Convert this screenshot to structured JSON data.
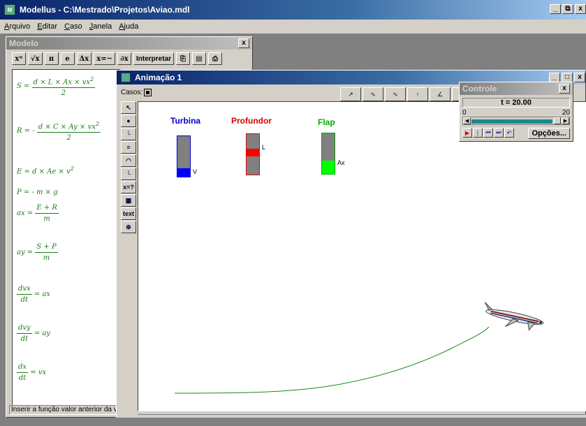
{
  "app": {
    "title": "Modellus - C:\\Mestrado\\Projetos\\Aviao.mdl",
    "min": "_",
    "max": "🗗",
    "close": "x"
  },
  "menu": [
    "Arquivo",
    "Editar",
    "Caso",
    "Janela",
    "Ajuda"
  ],
  "modelo": {
    "title": "Modelo",
    "close": "x",
    "toolbar": [
      "xⁿ",
      "√x",
      "π",
      "e",
      "Δx",
      "x=~",
      "∂x",
      "Interpretar"
    ],
    "status": "Inserir a função valor anterior da var",
    "equations": {
      "S": {
        "lhs": "S =",
        "num": "d × L × Ax × vx",
        "exp": "2",
        "den": "2"
      },
      "R": {
        "lhs": "R = -",
        "num": "d × C × Ay × vx",
        "exp": "2",
        "den": "2"
      },
      "E": {
        "text": "E = d × Ae × v",
        "exp": "2"
      },
      "P": {
        "text": "P = - m × g"
      },
      "ax": {
        "lhs": "ax =",
        "num": "E + R",
        "den": "m"
      },
      "ay": {
        "lhs": "ay =",
        "num": "S + P",
        "den": "m"
      },
      "dvx": {
        "num": "dvx",
        "den": "dt",
        "rhs": "= ax"
      },
      "dvy": {
        "num": "dvy",
        "den": "dt",
        "rhs": "= ay"
      },
      "dx": {
        "num": "dx",
        "den": "dt",
        "rhs": "= vx"
      }
    }
  },
  "animacao": {
    "title": "Animação 1",
    "casos_label": "Casos:",
    "left_tools": [
      "↖",
      "●",
      "└",
      "≡",
      "◠",
      "└",
      "x=?",
      "▦",
      "text",
      "⊕"
    ],
    "gauges": [
      {
        "label": "Turbina",
        "color": "#0000cc",
        "fill_color": "#0000ff",
        "level": 0.2,
        "tag": "V"
      },
      {
        "label": "Profundor",
        "color": "#dd0000",
        "fill_color": "#ff0000",
        "level": 0.48,
        "tag": "L"
      },
      {
        "label": "Flap",
        "color": "#00aa00",
        "fill_color": "#00ff00",
        "level": 0.32,
        "tag": "Ax"
      }
    ]
  },
  "controle": {
    "title": "Controle",
    "close": "x",
    "time": "t =  20.00",
    "scale_min": "0",
    "scale_max": "20",
    "opcoes": "Opções..."
  }
}
